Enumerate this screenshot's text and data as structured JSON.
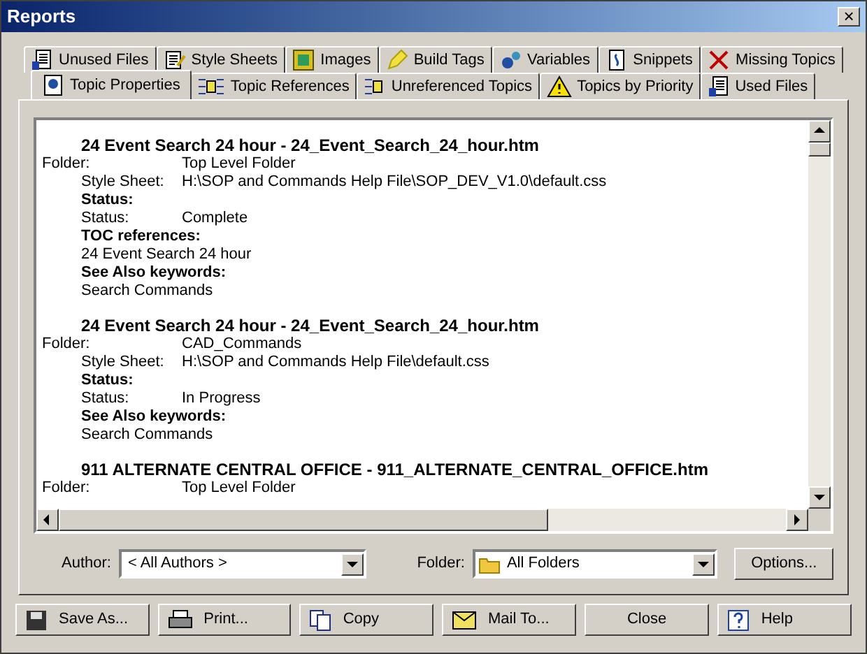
{
  "window": {
    "title": "Reports",
    "close": "×"
  },
  "tab_rows": [
    [
      {
        "label": "Unused Files",
        "selected": false
      },
      {
        "label": "Style Sheets",
        "selected": false
      },
      {
        "label": "Images",
        "selected": false
      },
      {
        "label": "Build Tags",
        "selected": false
      },
      {
        "label": "Variables",
        "selected": false
      },
      {
        "label": "Snippets",
        "selected": false
      },
      {
        "label": "Missing Topics",
        "selected": false
      }
    ],
    [
      {
        "label": "Topic Properties",
        "selected": true
      },
      {
        "label": "Topic References",
        "selected": false
      },
      {
        "label": "Unreferenced Topics",
        "selected": false
      },
      {
        "label": "Topics by Priority",
        "selected": false
      },
      {
        "label": "Used Files",
        "selected": false
      }
    ]
  ],
  "report_lines": [
    {
      "kind": "title",
      "text": "24 Event Search 24 hour - 24_Event_Search_24_hour.htm"
    },
    {
      "kind": "folder",
      "label": "Folder:",
      "value": "Top Level Folder"
    },
    {
      "kind": "field",
      "label": "Style Sheet:",
      "value": "H:\\SOP and Commands Help File\\SOP_DEV_V1.0\\default.css"
    },
    {
      "kind": "heading",
      "text": "Status:"
    },
    {
      "kind": "field",
      "label": "Status:",
      "value": "Complete"
    },
    {
      "kind": "heading",
      "text": "TOC references:"
    },
    {
      "kind": "text",
      "text": "24 Event Search 24 hour"
    },
    {
      "kind": "heading",
      "text": "See Also keywords:"
    },
    {
      "kind": "text",
      "text": "Search Commands"
    },
    {
      "kind": "title",
      "text": "24 Event Search 24 hour - 24_Event_Search_24_hour.htm"
    },
    {
      "kind": "folder",
      "label": "Folder:",
      "value": "CAD_Commands"
    },
    {
      "kind": "field",
      "label": "Style Sheet:",
      "value": "H:\\SOP and Commands Help File\\default.css"
    },
    {
      "kind": "heading",
      "text": "Status:"
    },
    {
      "kind": "field",
      "label": "Status:",
      "value": "In Progress"
    },
    {
      "kind": "heading",
      "text": "See Also keywords:"
    },
    {
      "kind": "text",
      "text": "Search Commands"
    },
    {
      "kind": "title",
      "text": "911 ALTERNATE CENTRAL OFFICE - 911_ALTERNATE_CENTRAL_OFFICE.htm"
    },
    {
      "kind": "folder",
      "label": "Folder:",
      "value": "Top Level Folder"
    }
  ],
  "filters": {
    "author_label": "Author:",
    "author_value": "< All Authors >",
    "folder_label": "Folder:",
    "folder_value": "All Folders",
    "options_button": "Options..."
  },
  "buttons": [
    "Save As...",
    "Print...",
    "Copy",
    "Mail To...",
    "Close",
    "Help"
  ]
}
